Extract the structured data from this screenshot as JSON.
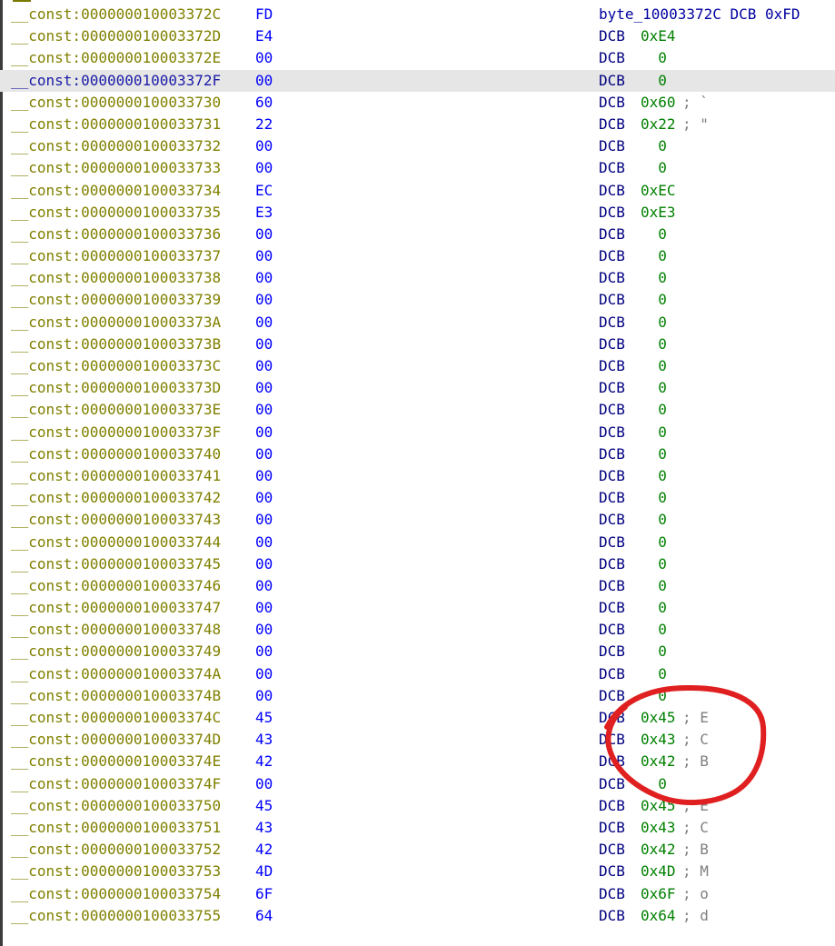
{
  "listing": {
    "rows": [
      {
        "prefix": "__const:000000010003372C",
        "bytes": "FD",
        "label": "byte_10003372C DCB 0xFD",
        "directive": "",
        "operand": "",
        "comment": ""
      },
      {
        "prefix": "__const:000000010003372D",
        "bytes": "E4",
        "label": "",
        "directive": "DCB",
        "operand": "0xE4",
        "comment": ""
      },
      {
        "prefix": "__const:000000010003372E",
        "bytes": "00",
        "label": "",
        "directive": "DCB",
        "operand": "  0",
        "comment": ""
      },
      {
        "prefix": "__const:000000010003372F",
        "bytes": "00",
        "label": "",
        "directive": "DCB",
        "operand": "  0",
        "comment": "",
        "selected": true
      },
      {
        "prefix": "__const:0000000100033730",
        "bytes": "60",
        "label": "",
        "directive": "DCB",
        "operand": "0x60",
        "comment": "; `"
      },
      {
        "prefix": "__const:0000000100033731",
        "bytes": "22",
        "label": "",
        "directive": "DCB",
        "operand": "0x22",
        "comment": "; \""
      },
      {
        "prefix": "__const:0000000100033732",
        "bytes": "00",
        "label": "",
        "directive": "DCB",
        "operand": "  0",
        "comment": ""
      },
      {
        "prefix": "__const:0000000100033733",
        "bytes": "00",
        "label": "",
        "directive": "DCB",
        "operand": "  0",
        "comment": ""
      },
      {
        "prefix": "__const:0000000100033734",
        "bytes": "EC",
        "label": "",
        "directive": "DCB",
        "operand": "0xEC",
        "comment": ""
      },
      {
        "prefix": "__const:0000000100033735",
        "bytes": "E3",
        "label": "",
        "directive": "DCB",
        "operand": "0xE3",
        "comment": ""
      },
      {
        "prefix": "__const:0000000100033736",
        "bytes": "00",
        "label": "",
        "directive": "DCB",
        "operand": "  0",
        "comment": ""
      },
      {
        "prefix": "__const:0000000100033737",
        "bytes": "00",
        "label": "",
        "directive": "DCB",
        "operand": "  0",
        "comment": ""
      },
      {
        "prefix": "__const:0000000100033738",
        "bytes": "00",
        "label": "",
        "directive": "DCB",
        "operand": "  0",
        "comment": ""
      },
      {
        "prefix": "__const:0000000100033739",
        "bytes": "00",
        "label": "",
        "directive": "DCB",
        "operand": "  0",
        "comment": ""
      },
      {
        "prefix": "__const:000000010003373A",
        "bytes": "00",
        "label": "",
        "directive": "DCB",
        "operand": "  0",
        "comment": ""
      },
      {
        "prefix": "__const:000000010003373B",
        "bytes": "00",
        "label": "",
        "directive": "DCB",
        "operand": "  0",
        "comment": ""
      },
      {
        "prefix": "__const:000000010003373C",
        "bytes": "00",
        "label": "",
        "directive": "DCB",
        "operand": "  0",
        "comment": ""
      },
      {
        "prefix": "__const:000000010003373D",
        "bytes": "00",
        "label": "",
        "directive": "DCB",
        "operand": "  0",
        "comment": ""
      },
      {
        "prefix": "__const:000000010003373E",
        "bytes": "00",
        "label": "",
        "directive": "DCB",
        "operand": "  0",
        "comment": ""
      },
      {
        "prefix": "__const:000000010003373F",
        "bytes": "00",
        "label": "",
        "directive": "DCB",
        "operand": "  0",
        "comment": ""
      },
      {
        "prefix": "__const:0000000100033740",
        "bytes": "00",
        "label": "",
        "directive": "DCB",
        "operand": "  0",
        "comment": ""
      },
      {
        "prefix": "__const:0000000100033741",
        "bytes": "00",
        "label": "",
        "directive": "DCB",
        "operand": "  0",
        "comment": ""
      },
      {
        "prefix": "__const:0000000100033742",
        "bytes": "00",
        "label": "",
        "directive": "DCB",
        "operand": "  0",
        "comment": ""
      },
      {
        "prefix": "__const:0000000100033743",
        "bytes": "00",
        "label": "",
        "directive": "DCB",
        "operand": "  0",
        "comment": ""
      },
      {
        "prefix": "__const:0000000100033744",
        "bytes": "00",
        "label": "",
        "directive": "DCB",
        "operand": "  0",
        "comment": ""
      },
      {
        "prefix": "__const:0000000100033745",
        "bytes": "00",
        "label": "",
        "directive": "DCB",
        "operand": "  0",
        "comment": ""
      },
      {
        "prefix": "__const:0000000100033746",
        "bytes": "00",
        "label": "",
        "directive": "DCB",
        "operand": "  0",
        "comment": ""
      },
      {
        "prefix": "__const:0000000100033747",
        "bytes": "00",
        "label": "",
        "directive": "DCB",
        "operand": "  0",
        "comment": ""
      },
      {
        "prefix": "__const:0000000100033748",
        "bytes": "00",
        "label": "",
        "directive": "DCB",
        "operand": "  0",
        "comment": ""
      },
      {
        "prefix": "__const:0000000100033749",
        "bytes": "00",
        "label": "",
        "directive": "DCB",
        "operand": "  0",
        "comment": ""
      },
      {
        "prefix": "__const:000000010003374A",
        "bytes": "00",
        "label": "",
        "directive": "DCB",
        "operand": "  0",
        "comment": ""
      },
      {
        "prefix": "__const:000000010003374B",
        "bytes": "00",
        "label": "",
        "directive": "DCB",
        "operand": "  0",
        "comment": ""
      },
      {
        "prefix": "__const:000000010003374C",
        "bytes": "45",
        "label": "",
        "directive": "DCB",
        "operand": "0x45",
        "comment": "; E"
      },
      {
        "prefix": "__const:000000010003374D",
        "bytes": "43",
        "label": "",
        "directive": "DCB",
        "operand": "0x43",
        "comment": "; C"
      },
      {
        "prefix": "__const:000000010003374E",
        "bytes": "42",
        "label": "",
        "directive": "DCB",
        "operand": "0x42",
        "comment": "; B"
      },
      {
        "prefix": "__const:000000010003374F",
        "bytes": "00",
        "label": "",
        "directive": "DCB",
        "operand": "  0",
        "comment": ""
      },
      {
        "prefix": "__const:0000000100033750",
        "bytes": "45",
        "label": "",
        "directive": "DCB",
        "operand": "0x45",
        "comment": "; E"
      },
      {
        "prefix": "__const:0000000100033751",
        "bytes": "43",
        "label": "",
        "directive": "DCB",
        "operand": "0x43",
        "comment": "; C"
      },
      {
        "prefix": "__const:0000000100033752",
        "bytes": "42",
        "label": "",
        "directive": "DCB",
        "operand": "0x42",
        "comment": "; B"
      },
      {
        "prefix": "__const:0000000100033753",
        "bytes": "4D",
        "label": "",
        "directive": "DCB",
        "operand": "0x4D",
        "comment": "; M"
      },
      {
        "prefix": "__const:0000000100033754",
        "bytes": "6F",
        "label": "",
        "directive": "DCB",
        "operand": "0x6F",
        "comment": "; o"
      },
      {
        "prefix": "__const:0000000100033755",
        "bytes": "64",
        "label": "",
        "directive": "DCB",
        "operand": "0x64",
        "comment": "; d"
      }
    ]
  },
  "annotation": {
    "shape": "freehand-circle",
    "color": "#e02020"
  }
}
